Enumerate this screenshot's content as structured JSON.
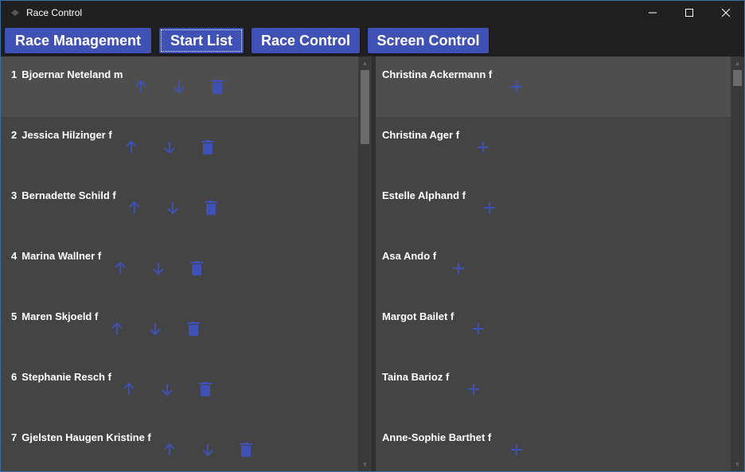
{
  "window": {
    "title": "Race Control"
  },
  "toolbar": {
    "buttons": [
      {
        "label": "Race Management"
      },
      {
        "label": "Start List"
      },
      {
        "label": "Race Control"
      },
      {
        "label": "Screen Control"
      }
    ]
  },
  "start_list": [
    {
      "num": "1",
      "name": "Bjoernar Neteland m"
    },
    {
      "num": "2",
      "name": "Jessica Hilzinger f"
    },
    {
      "num": "3",
      "name": "Bernadette Schild f"
    },
    {
      "num": "4",
      "name": "Marina Wallner f"
    },
    {
      "num": "5",
      "name": "Maren Skjoeld f"
    },
    {
      "num": "6",
      "name": "Stephanie Resch f"
    },
    {
      "num": "7",
      "name": "Gjelsten Haugen Kristine f"
    }
  ],
  "available": [
    {
      "name": "Christina Ackermann f"
    },
    {
      "name": "Christina Ager f"
    },
    {
      "name": "Estelle Alphand f"
    },
    {
      "name": "Asa Ando f"
    },
    {
      "name": "Margot Bailet f"
    },
    {
      "name": "Taina Barioz f"
    },
    {
      "name": "Anne-Sophie Barthet f"
    }
  ],
  "colors": {
    "accent": "#3f51b5",
    "icon": "#3f51b5",
    "background": "#444444"
  },
  "icons": {
    "up": "arrow-up-icon",
    "down": "arrow-down-icon",
    "delete": "trash-icon",
    "add": "plus-icon"
  }
}
